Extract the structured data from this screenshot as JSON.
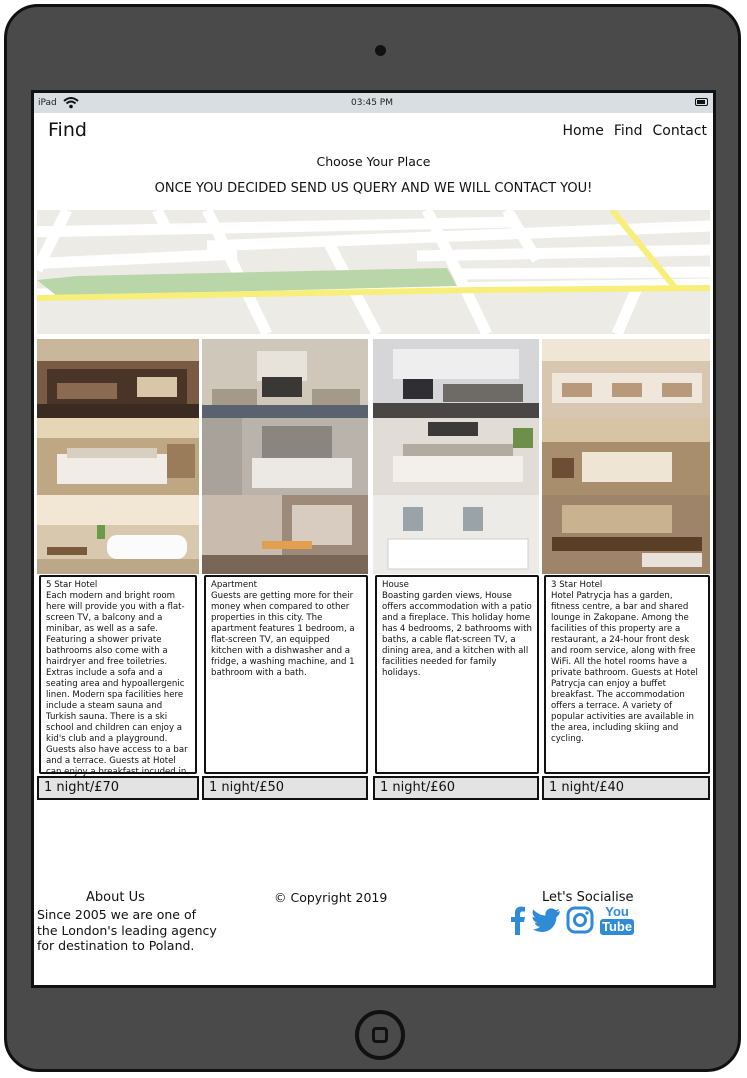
{
  "status_bar": {
    "carrier": "iPad",
    "time": "03:45 PM"
  },
  "brand": "Find",
  "nav": {
    "home": "Home",
    "find": "Find",
    "contact": "Contact"
  },
  "subtitle": "Choose Your Place",
  "tagline": "ONCE YOU DECIDED SEND US QUERY AND WE WILL CONTACT YOU!",
  "colors": {
    "map_bg": "#ecebe6",
    "road": "#ffffff",
    "highway": "#f7ef7a",
    "park": "#b9d6a8",
    "price_bg": "#e3e3e3",
    "social": "#2f8bd6"
  },
  "listings": [
    {
      "name": "5 Star Hotel",
      "description": "Each modern and bright room here will provide you with a flat-screen TV, a balcony and a minibar, as well as a safe. Featuring a shower private bathrooms also come with a hairdryer and free toiletries. Extras include a sofa and a seating area and hypoallergenic linen. Modern spa facilities here include a steam sauna and Turkish sauna. There is a ski school and children can enjoy a kid's club and a playground. Guests also have access to a bar and a terrace. Guests at Hotel can enjoy a breakfast incuded in the price.",
      "price": "1 night/£70"
    },
    {
      "name": "Apartment",
      "description": "Guests are getting more for their money when compared to other properties in this city. The apartment features 1 bedroom, a flat-screen TV, an equipped kitchen with a dishwasher and a fridge, a washing machine, and 1 bathroom with a bath.",
      "price": "1 night/£50"
    },
    {
      "name": "House",
      "description": "Boasting garden views, House offers accommodation with a patio and a fireplace. This holiday home has 4 bedrooms, 2 bathrooms with baths, a cable flat-screen TV, a dining area, and a kitchen with all facilities needed for family holidays.",
      "price": "1 night/£60"
    },
    {
      "name": "3 Star Hotel",
      "description": "Hotel Patrycja has a garden, fitness centre, a bar and shared lounge in Zakopane. Among the facilities of this property are a restaurant, a 24-hour front desk and room service, along with free WiFi. All the hotel rooms have a private bathroom. Guests at Hotel Patrycja can enjoy a buffet breakfast. The accommodation offers a terrace. A variety of popular activities are available in the area, including skiing and cycling.",
      "price": "1 night/£40"
    }
  ],
  "footer": {
    "about_title": "About Us",
    "about_text": "Since 2005 we are one of the London's leading agency for destination to Poland.",
    "copyright": "© Copyright 2019",
    "social_title": "Let's Socialise",
    "social_icons": [
      "facebook-icon",
      "twitter-icon",
      "instagram-icon",
      "youtube-icon"
    ],
    "youtube_you": "You",
    "youtube_tube": "Tube"
  }
}
